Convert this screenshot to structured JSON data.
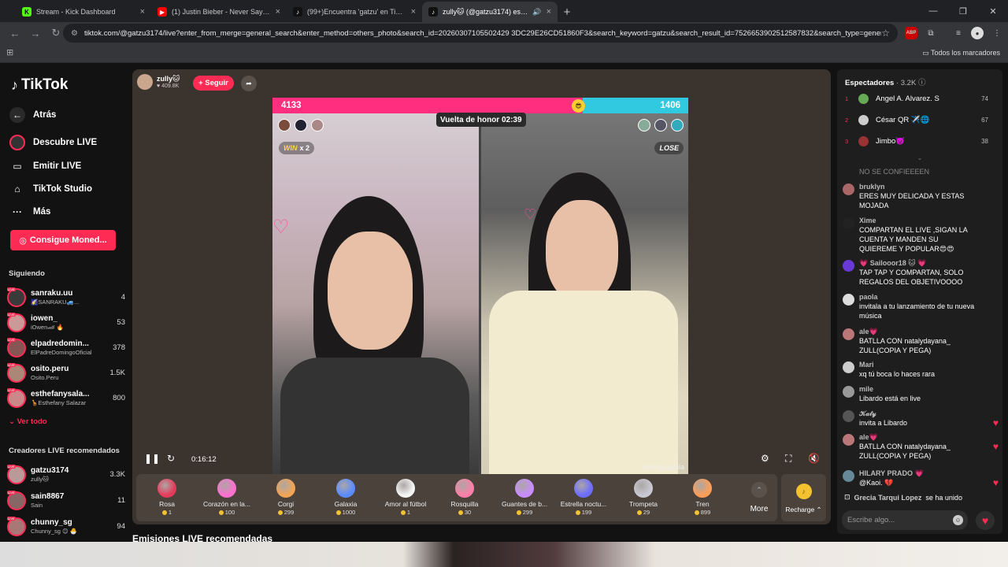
{
  "browser": {
    "tabs": [
      {
        "title": "Stream - Kick Dashboard",
        "fav": "K",
        "favcolor": "#53fc18",
        "active": false
      },
      {
        "title": "(1) Justin Bieber - Never Say Never ft. Jaden Smith",
        "fav": "▶",
        "favcolor": "#ff0000",
        "active": false
      },
      {
        "title": "(99+)Encuentra 'gatzu' en TikTok",
        "fav": "♪",
        "favcolor": "#111111",
        "active": false
      },
      {
        "title": "zully🐱 (@gatzu3174) está en LIVE",
        "fav": "♪",
        "favcolor": "#111111",
        "active": true
      }
    ],
    "url": "tiktok.com/@gatzu3174/live?enter_from_merge=general_search&enter_method=others_photo&search_id=20260307105502429 3DC29E26CD51860F3&search_keyword=gatzu&search_result_id=7526653902512587832&search_type=general",
    "bookmarks_label": "Todos los marcadores"
  },
  "sidebar": {
    "logo": "TikTok",
    "nav": [
      {
        "label": "Atrás",
        "icon": "←"
      },
      {
        "label": "Descubre LIVE",
        "icon": ""
      },
      {
        "label": "Emitir LIVE",
        "icon": "▭"
      },
      {
        "label": "TikTok Studio",
        "icon": "⌂"
      },
      {
        "label": "Más",
        "icon": "···"
      }
    ],
    "coins_button": "Consigue Moned...",
    "following_title": "Siguiendo",
    "following": [
      {
        "name": "sanraku.uu",
        "sub": "🌠SANRAKU🚙...",
        "count": "4"
      },
      {
        "name": "iowen_",
        "sub": "iOwen🏎 🔥",
        "count": "53"
      },
      {
        "name": "elpadredomin...",
        "sub": "ElPadreDomingoOficial",
        "count": "378"
      },
      {
        "name": "osito.peru",
        "sub": "Osito.Peru",
        "count": "1.5K"
      },
      {
        "name": "esthefanysala...",
        "sub": "🦒Esthefany Salazar",
        "count": "800"
      }
    ],
    "see_all": "Ver todo",
    "recommended_title": "Creadores LIVE recomendados",
    "recommended": [
      {
        "name": "gatzu3174",
        "sub": "zully🐱",
        "count": "3.3K"
      },
      {
        "name": "sain8867",
        "sub": "Sain",
        "count": "11"
      },
      {
        "name": "chunny_sg",
        "sub": "Chunny_sg 😊 🐣",
        "count": "94"
      }
    ]
  },
  "stream": {
    "host_name": "zully🐱",
    "host_likes": "♥ 409.8K",
    "follow_label": "+ Seguir",
    "battle": {
      "left_score": "4133",
      "right_score": "1406",
      "left_fraction": 0.746,
      "timer": "Vuelta de honor 02:39",
      "win_label": "WIN",
      "win_mult": "x 2",
      "lose_label": "LOSE",
      "right_watermark": "valerya.ayala"
    },
    "time": "0:16:12",
    "below_title": "Emisiones LIVE recomendadas"
  },
  "gifts": [
    {
      "name": "Rosa",
      "price": "1",
      "color": "#e63a5a"
    },
    {
      "name": "Corazón en la...",
      "price": "100",
      "color": "#ff6fcf"
    },
    {
      "name": "Corgi",
      "price": "299",
      "color": "#f2a455"
    },
    {
      "name": "Galaxia",
      "price": "1000",
      "color": "#5a8cff"
    },
    {
      "name": "Amor al fútbol",
      "price": "1",
      "color": "#f5f5f5"
    },
    {
      "name": "Rosquilla",
      "price": "30",
      "color": "#ff7fa8"
    },
    {
      "name": "Guantes de b...",
      "price": "299",
      "color": "#c88cff"
    },
    {
      "name": "Estrella noctu...",
      "price": "199",
      "color": "#6d6dff"
    },
    {
      "name": "Trompeta",
      "price": "29",
      "color": "#c8c8d2"
    },
    {
      "name": "Tren",
      "price": "899",
      "color": "#ff9d57"
    }
  ],
  "more_label": "More",
  "recharge_label": "Recharge ⌃",
  "chat": {
    "viewers_title": "Espectadores",
    "viewers_count": "· 3.2K",
    "top_viewers": [
      {
        "rank": "1",
        "name": "Angel A. Alvarez. S",
        "score": "74"
      },
      {
        "rank": "2",
        "name": "César QR ✈️🌐",
        "score": "67"
      },
      {
        "rank": "3",
        "name": "Jimbo👿",
        "score": "38"
      }
    ],
    "faded_msg": "NO SE CONFIEEEEN",
    "messages": [
      {
        "user": "bruklyn",
        "text": "ERES MUY DELICADA Y ESTAS MOJADA",
        "liked": false
      },
      {
        "user": "Xime",
        "text": "COMPARTAN EL LIVE ,SIGAN LA CUENTA Y MANDEN SU QUIEREME Y POPULAR😍😍",
        "liked": false
      },
      {
        "user": "💗 Sailooor18 🐱 💗",
        "text": "TAP TAP Y COMPARTAN, SOLO REGALOS DEL OBJETIVOOOO",
        "liked": false
      },
      {
        "user": "paola",
        "text": "invitala a tu lanzamiento de tu nueva música",
        "liked": false
      },
      {
        "user": "ale💗",
        "text": "BATLLA CON natalydayana_ ZULL(COPIA Y PEGA)",
        "liked": false
      },
      {
        "user": "Mari",
        "text": "xq tú boca lo haces rara",
        "liked": false
      },
      {
        "user": "mile",
        "text": "Libardo está en live",
        "liked": false
      },
      {
        "user": "𝒦𝒶𝓉𝓎",
        "text": "invita a Libardo",
        "liked": true
      },
      {
        "user": "ale💗",
        "text": "BATLLA CON natalydayana_ ZULL(COPIA Y PEGA)",
        "liked": true
      },
      {
        "user": "HILARY PRADO 💗",
        "text": "@Kaoi. 💔",
        "liked": true
      }
    ],
    "join_user": "Grecia Tarqui Lopez",
    "join_text": "se ha unido",
    "input_placeholder": "Escribe algo..."
  }
}
